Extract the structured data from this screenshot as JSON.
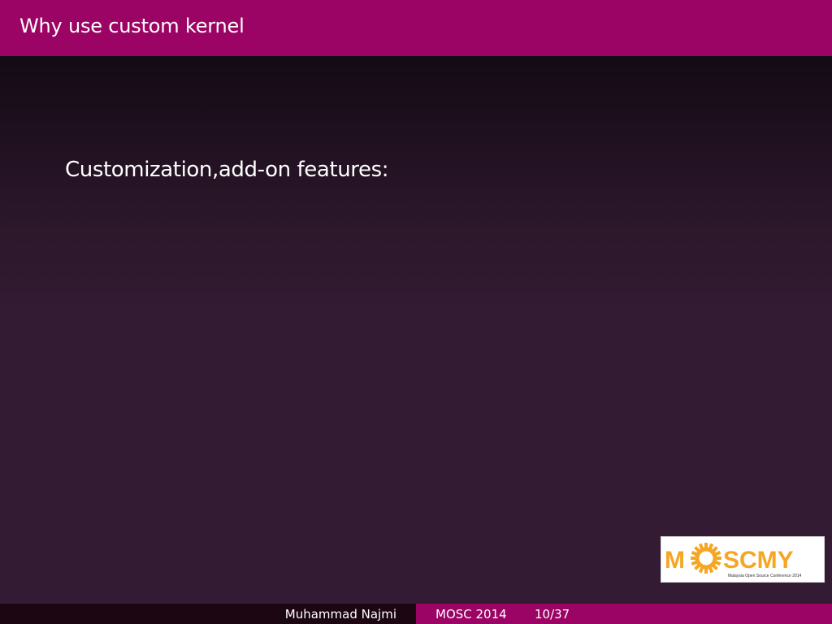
{
  "slide": {
    "title": "Why use custom kernel",
    "body": "Customization,add-on features:"
  },
  "logo": {
    "text": "MOSCMY",
    "tagline": "Malaysia Open Source Conference 2014",
    "icon": "gear-sun-icon",
    "colors": {
      "orange": "#f5a623",
      "background": "#ffffff"
    }
  },
  "footer": {
    "author": "Muhammad Najmi",
    "event": "MOSC 2014",
    "page": "10/37"
  },
  "colors": {
    "accent": "#9b0464",
    "footer_dark": "#1b0611",
    "background": "#331b33",
    "text": "#ffffff"
  }
}
